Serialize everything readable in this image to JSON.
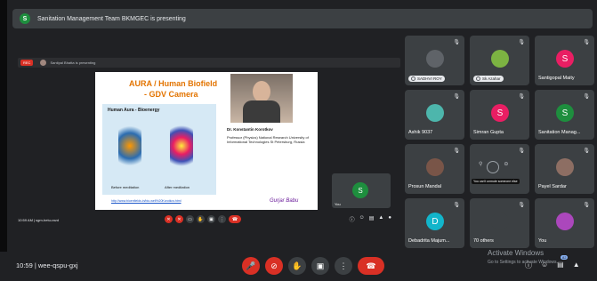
{
  "banner": {
    "text": "Sanitation Management Team BKMGEC is presenting",
    "badge": "S"
  },
  "stage": {
    "rec": "REC",
    "presenter_line": "Santipal Bhatta is presenting",
    "slide": {
      "title_line1": "AURA / Human Biofield",
      "title_line2": "- GDV Camera",
      "aura_title": "Human Aura - Bioenergy",
      "caption_before": "Before meditation",
      "caption_after": "After meditation",
      "author": "Dr. Konstantin Korotkov",
      "description": "Professor (Physics) National Research University of Informational Technologies St Petersburg, Russia",
      "link": "http://www.bioenfields.in/bio-well%20Korotkov.html",
      "signature": "Gurjar Babu"
    },
    "self_tile": {
      "initial": "S",
      "name": "You"
    },
    "footer": {
      "meeting": "10:59 AM  |  sgm-hetu-ravd"
    }
  },
  "participants": [
    {
      "name": "SADHVI ROY",
      "type": "pill",
      "avatar_color": "#5f6368",
      "avatar_text": ""
    },
    {
      "name": "Sk Azahar",
      "type": "pill",
      "avatar_color": "#7cb342",
      "avatar_text": ""
    },
    {
      "name": "Santigopal Maity",
      "type": "label",
      "avatar_color": "#e91e63",
      "avatar_text": "S"
    },
    {
      "name": "Ashik 9037",
      "type": "label",
      "avatar_color": "#4db6ac",
      "avatar_text": ""
    },
    {
      "name": "Simran Gupta",
      "type": "label",
      "avatar_color": "#e91e63",
      "avatar_text": "S"
    },
    {
      "name": "Sanitation Manag...",
      "type": "label",
      "avatar_color": "#1e8e3e",
      "avatar_text": "S"
    },
    {
      "name": "Prosun Mandal",
      "type": "label",
      "avatar_color": "#795548",
      "avatar_text": ""
    },
    {
      "name": "You can't unmute someone else",
      "type": "tooltip",
      "avatar_color": "#3c4043",
      "avatar_text": ""
    },
    {
      "name": "Payel Sardar",
      "type": "label",
      "avatar_color": "#8d6e63",
      "avatar_text": ""
    },
    {
      "name": "Debadrita Majum...",
      "type": "label",
      "avatar_color": "#12b5cb",
      "avatar_text": "D"
    },
    {
      "name": "70 others",
      "type": "label",
      "avatar_color": "#3c4043",
      "avatar_text": ""
    },
    {
      "name": "You",
      "type": "label",
      "avatar_color": "#ab47bc",
      "avatar_text": ""
    }
  ],
  "toolbar": {
    "meeting_info": "10:59  |  wee-qspu-gxj",
    "badge_count": "82"
  },
  "watermark": {
    "line1": "Activate Windows",
    "line2": "Go to Settings to activate Windows."
  }
}
